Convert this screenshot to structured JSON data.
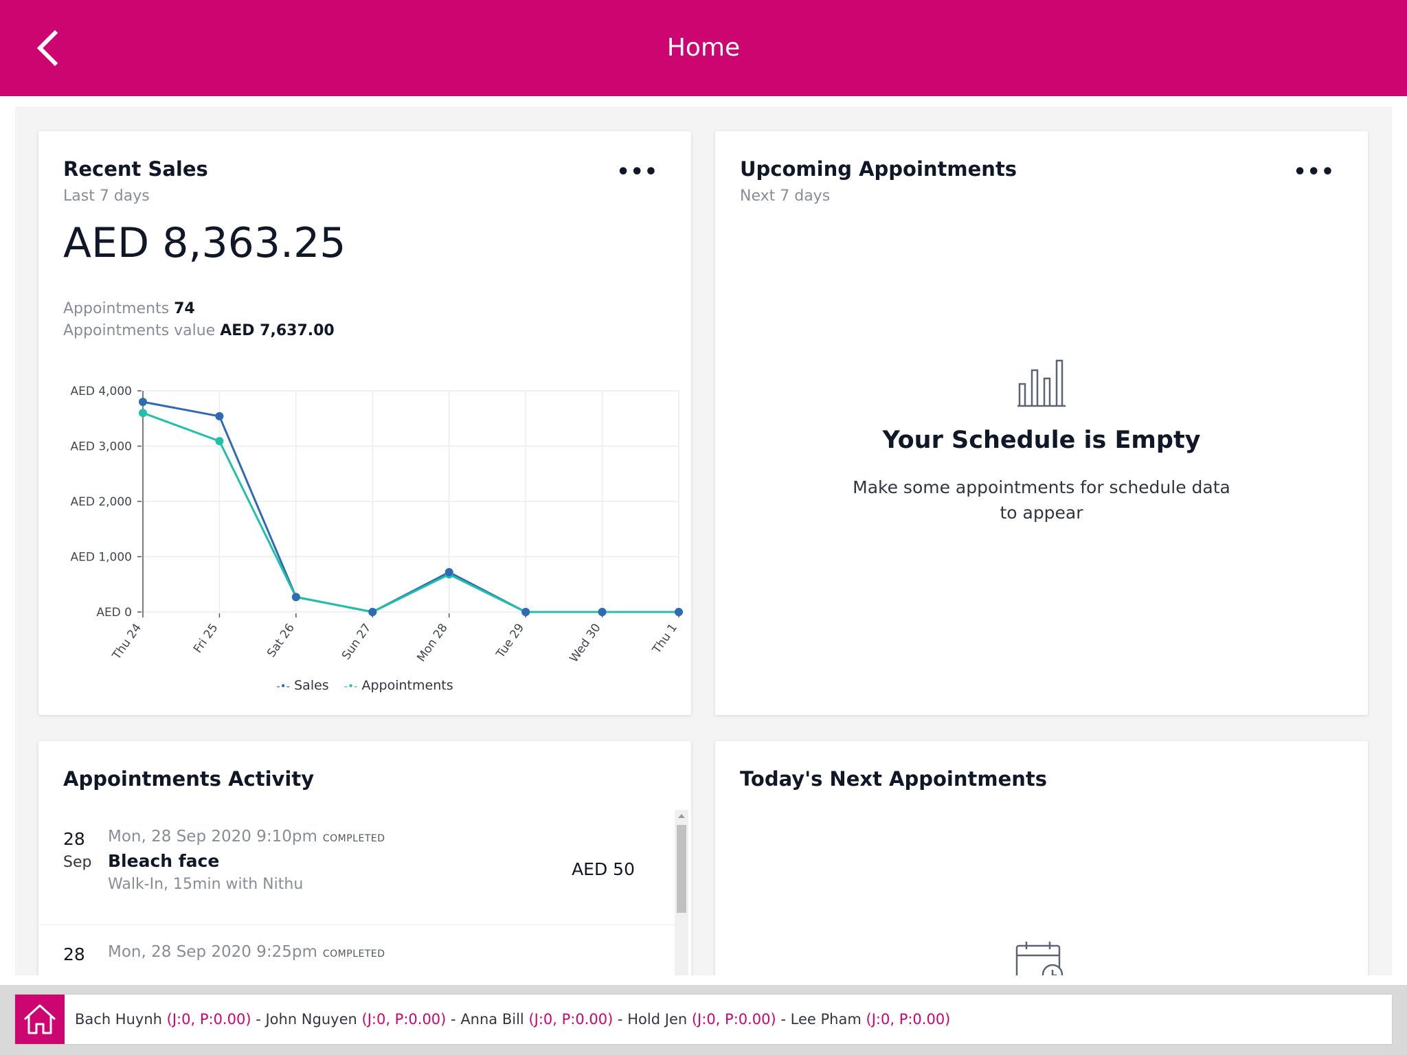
{
  "header": {
    "title": "Home",
    "back_icon": "chevron-left-icon"
  },
  "colors": {
    "brand": "#cc0571",
    "sales_series": "#2f6bb3",
    "appointments_series": "#20c0aa"
  },
  "recent_sales": {
    "title": "Recent Sales",
    "subtitle": "Last 7 days",
    "more_icon": "ellipsis-icon",
    "total": "AED 8,363.25",
    "appointments_label": "Appointments",
    "appointments_count": "74",
    "appointments_value_label": "Appointments value",
    "appointments_value": "AED 7,637.00"
  },
  "chart_data": {
    "type": "line",
    "categories": [
      "Thu 24",
      "Fri 25",
      "Sat 26",
      "Sun 27",
      "Mon 28",
      "Tue 29",
      "Wed 30",
      "Thu 1"
    ],
    "series": [
      {
        "name": "Sales",
        "values": [
          3800,
          3540,
          270,
          0,
          720,
          0,
          0,
          0
        ]
      },
      {
        "name": "Appointments",
        "values": [
          3600,
          3090,
          270,
          0,
          680,
          0,
          0,
          0
        ]
      }
    ],
    "y_ticks": [
      "AED 0",
      "AED 1,000",
      "AED 2,000",
      "AED 3,000",
      "AED 4,000"
    ],
    "ylim": [
      0,
      4000
    ],
    "grid": true,
    "legend": "bottom"
  },
  "upcoming": {
    "title": "Upcoming Appointments",
    "subtitle": "Next 7 days",
    "more_icon": "ellipsis-icon",
    "empty_icon": "bar-chart-icon",
    "empty_title": "Your Schedule is Empty",
    "empty_text": "Make some appointments for schedule data to appear"
  },
  "activity": {
    "title": "Appointments Activity",
    "items": [
      {
        "day": "28",
        "month": "Sep",
        "when": "Mon, 28 Sep 2020 9:10pm",
        "status": "COMPLETED",
        "name": "Bleach face",
        "detail": "Walk-In, 15min with Nithu",
        "price": "AED 50"
      },
      {
        "day": "28",
        "month": "",
        "when": "Mon, 28 Sep 2020 9:25pm",
        "status": "COMPLETED",
        "name": "",
        "detail": "",
        "price": ""
      }
    ]
  },
  "todays_next": {
    "title": "Today's Next Appointments",
    "icon": "calendar-clock-icon"
  },
  "bottom_bar": {
    "home_icon": "home-icon",
    "staff": [
      {
        "name": "Bach Huynh",
        "stats": "(J:0, P:0.00)"
      },
      {
        "name": "John Nguyen",
        "stats": "(J:0, P:0.00)"
      },
      {
        "name": "Anna Bill",
        "stats": "(J:0, P:0.00)"
      },
      {
        "name": "Hold Jen",
        "stats": "(J:0, P:0.00)"
      },
      {
        "name": "Lee Pham",
        "stats": "(J:0, P:0.00)"
      }
    ],
    "separator": " - "
  }
}
